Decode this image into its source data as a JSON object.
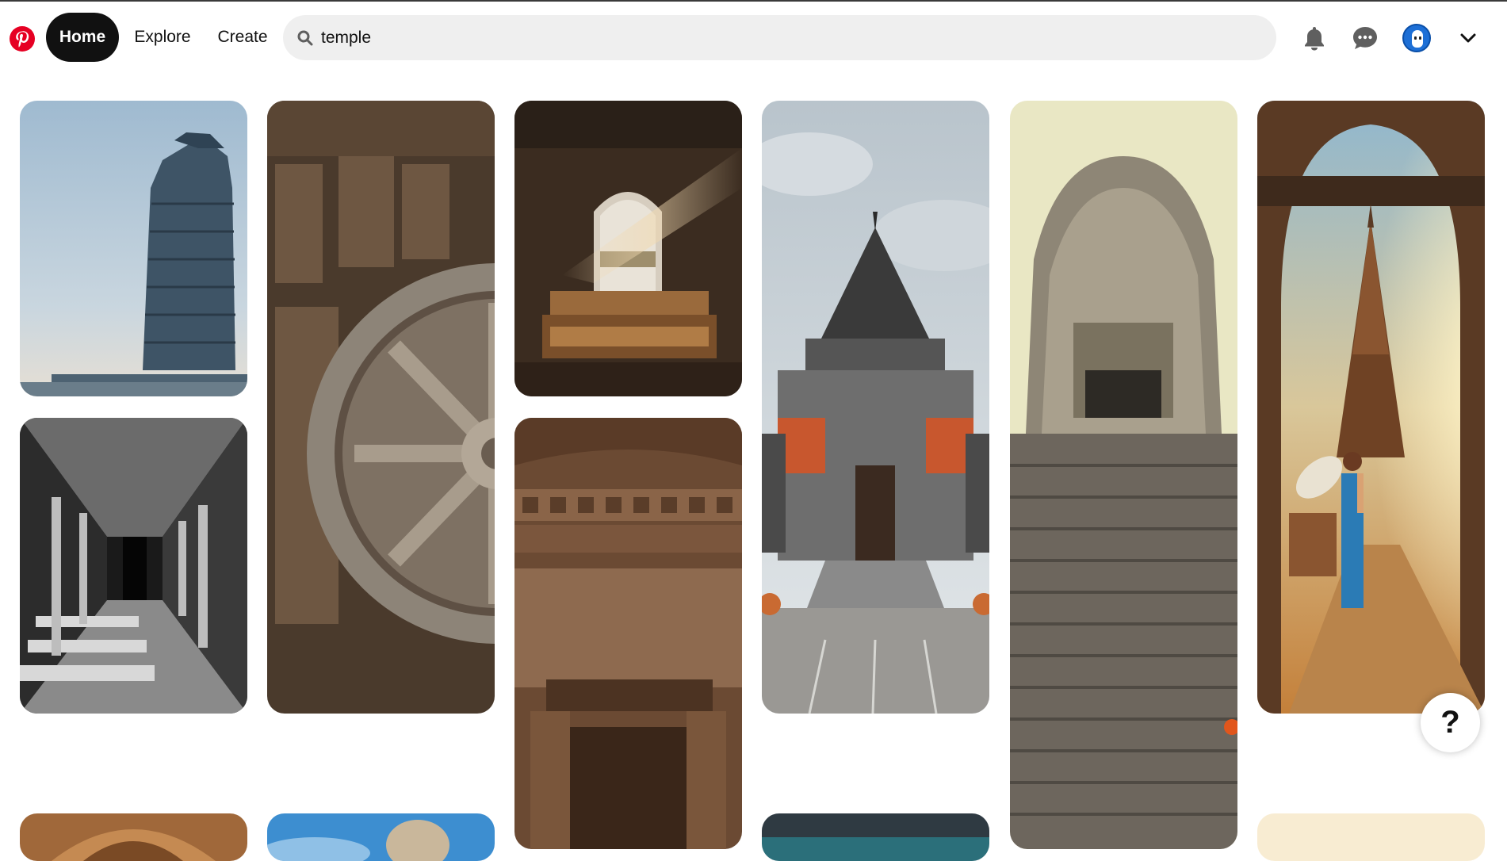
{
  "header": {
    "nav": {
      "home": "Home",
      "explore": "Explore",
      "create": "Create"
    },
    "search": {
      "value": "temple"
    },
    "icons": {
      "logo": "pinterest-logo",
      "search": "search-icon",
      "notifications": "bell-icon",
      "messages": "chat-icon",
      "profile": "avatar",
      "account_menu": "chevron-down-icon"
    }
  },
  "help": {
    "label": "?"
  },
  "colors": {
    "brand": "#e60023",
    "active_nav": "#111111",
    "search_bg": "#efefef"
  },
  "pins": [
    {
      "name": "pin-gopuram-tower"
    },
    {
      "name": "pin-konark-wheel"
    },
    {
      "name": "pin-arched-doorway-light"
    },
    {
      "name": "pin-balinese-temple-gate"
    },
    {
      "name": "pin-khmer-stone-tower"
    },
    {
      "name": "pin-woman-umbrella-temple"
    },
    {
      "name": "pin-pillared-corridor-bw"
    },
    {
      "name": "pin-carved-stone-interior"
    },
    {
      "name": "pin-arch-ceiling-partial"
    },
    {
      "name": "pin-blue-sky-statue-partial"
    },
    {
      "name": "pin-teal-roof-partial"
    },
    {
      "name": "pin-cream-partial"
    }
  ]
}
